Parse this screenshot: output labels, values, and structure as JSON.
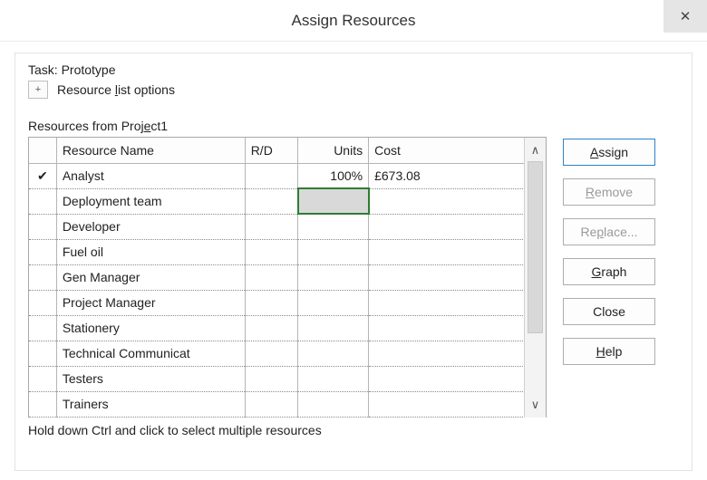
{
  "window": {
    "title": "Assign Resources",
    "close_glyph": "✕"
  },
  "task": {
    "label": "Task:",
    "name": "Prototype"
  },
  "options": {
    "expand_glyph": "+",
    "label_pre": "Resource ",
    "label_hotkey": "l",
    "label_post": "ist options"
  },
  "resources_label_pre": "Resources from Proj",
  "resources_label_hotkey": "e",
  "resources_label_post": "ct1",
  "columns": {
    "check": "",
    "name": "Resource Name",
    "rd": "R/D",
    "units": "Units",
    "cost": "Cost"
  },
  "rows": [
    {
      "checked": true,
      "name": "Analyst",
      "rd": "",
      "units": "100%",
      "cost": "£673.08",
      "selected_col": null
    },
    {
      "checked": false,
      "name": "Deployment team",
      "rd": "",
      "units": "",
      "cost": "",
      "selected_col": "units"
    },
    {
      "checked": false,
      "name": "Developer",
      "rd": "",
      "units": "",
      "cost": "",
      "selected_col": null
    },
    {
      "checked": false,
      "name": "Fuel oil",
      "rd": "",
      "units": "",
      "cost": "",
      "selected_col": null
    },
    {
      "checked": false,
      "name": "Gen Manager",
      "rd": "",
      "units": "",
      "cost": "",
      "selected_col": null
    },
    {
      "checked": false,
      "name": "Project Manager",
      "rd": "",
      "units": "",
      "cost": "",
      "selected_col": null
    },
    {
      "checked": false,
      "name": "Stationery",
      "rd": "",
      "units": "",
      "cost": "",
      "selected_col": null
    },
    {
      "checked": false,
      "name": "Technical Communicat",
      "rd": "",
      "units": "",
      "cost": "",
      "selected_col": null
    },
    {
      "checked": false,
      "name": "Testers",
      "rd": "",
      "units": "",
      "cost": "",
      "selected_col": null
    },
    {
      "checked": false,
      "name": "Trainers",
      "rd": "",
      "units": "",
      "cost": "",
      "selected_col": null
    }
  ],
  "check_glyph": "✔",
  "scroll": {
    "up": "∧",
    "down": "∨"
  },
  "buttons": {
    "assign_hot": "A",
    "assign_rest": "ssign",
    "remove_hot": "R",
    "remove_rest": "emove",
    "replace_pre": "Re",
    "replace_hot": "p",
    "replace_rest": "lace...",
    "graph_hot": "G",
    "graph_rest": "raph",
    "close": "Close",
    "help_hot": "H",
    "help_rest": "elp"
  },
  "hint": "Hold down Ctrl and click to select multiple resources"
}
